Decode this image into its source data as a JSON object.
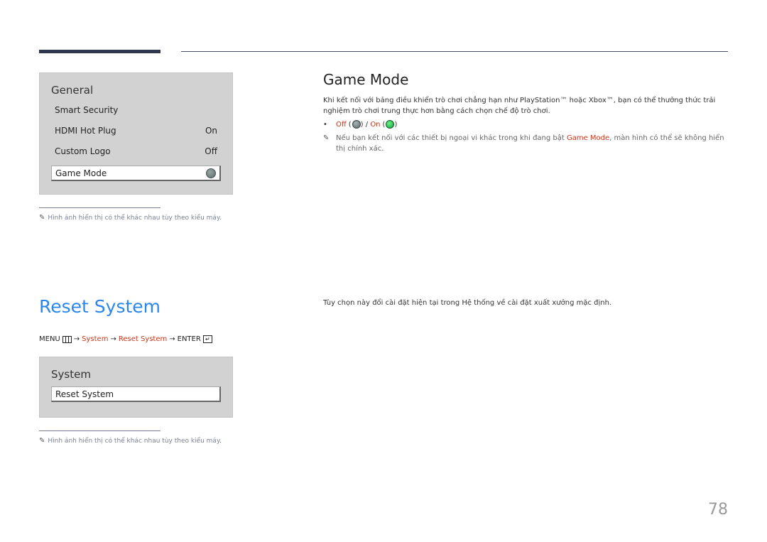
{
  "general_panel": {
    "title": "General",
    "items": [
      {
        "label": "Smart Security",
        "value": ""
      },
      {
        "label": "HDMI Hot Plug",
        "value": "On"
      },
      {
        "label": "Custom Logo",
        "value": "Off"
      },
      {
        "label": "Game Mode",
        "value": "",
        "selected": true,
        "toggle_state": "off"
      }
    ]
  },
  "note_model_varies": "Hình ảnh hiển thị có thể khác nhau tùy theo kiểu máy.",
  "game_mode": {
    "heading": "Game Mode",
    "description": "Khi kết nối với bảng điều khiển trò chơi chẳng hạn như PlayStation™ hoặc Xbox™, bạn có thể thưởng thức trải nghiệm trò chơi trung thực hơn bằng cách chọn chế độ trò chơi.",
    "option_off": "Off",
    "option_on": "On",
    "note_before": "Nếu bạn kết nối với các thiết bị ngoại vi khác trong khi đang bật ",
    "note_highlight": "Game Mode",
    "note_after": ", màn hình có thể sẽ không hiển thị chính xác."
  },
  "reset_system": {
    "heading": "Reset System",
    "description": "Tùy chọn này đổi cài đặt hiện tại trong Hệ thống về cài đặt xuất xưởng mặc định.",
    "path": {
      "menu": "MENU",
      "arrow": "→",
      "step1": "System",
      "step2": "Reset System",
      "enter": "ENTER"
    }
  },
  "system_panel": {
    "title": "System",
    "items": [
      {
        "label": "Reset System",
        "selected": true
      }
    ]
  },
  "page_number": "78",
  "colors": {
    "accent_blue": "#2b87f0",
    "accent_red": "#c8361a",
    "panel_gray": "#d2d2d2"
  }
}
